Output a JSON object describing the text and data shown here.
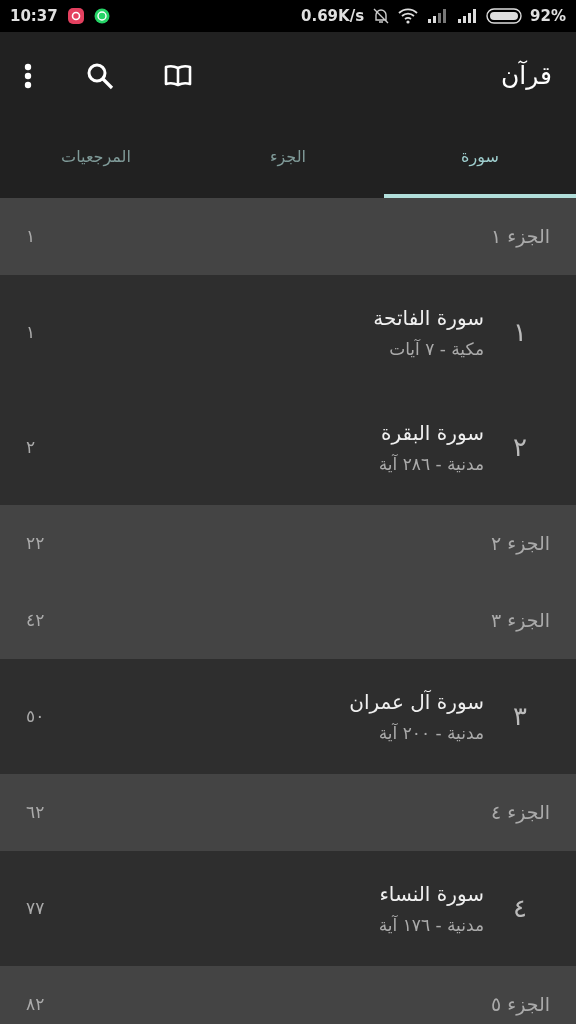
{
  "status_bar": {
    "time": "10:37",
    "speed": "0.69K/s",
    "battery": "92%"
  },
  "app_bar": {
    "title": "قرآن"
  },
  "tabs": [
    {
      "label": "سورة",
      "selected": true
    },
    {
      "label": "الجزء",
      "selected": false
    },
    {
      "label": "المرجعيات",
      "selected": false
    }
  ],
  "list": [
    {
      "kind": "juz",
      "title": "الجزء ١",
      "page": "١"
    },
    {
      "kind": "surah",
      "number": "١",
      "title": "سورة الفاتحة",
      "subtitle": "مكية - ٧ آيات",
      "page": "١"
    },
    {
      "kind": "surah",
      "number": "٢",
      "title": "سورة البقرة",
      "subtitle": "مدنية - ٢٨٦ آية",
      "page": "٢"
    },
    {
      "kind": "juz",
      "title": "الجزء ٢",
      "page": "٢٢"
    },
    {
      "kind": "juz",
      "title": "الجزء ٣",
      "page": "٤٢"
    },
    {
      "kind": "surah",
      "number": "٣",
      "title": "سورة آل عمران",
      "subtitle": "مدنية - ٢٠٠ آية",
      "page": "٥٠"
    },
    {
      "kind": "juz",
      "title": "الجزء ٤",
      "page": "٦٢"
    },
    {
      "kind": "surah",
      "number": "٤",
      "title": "سورة النساء",
      "subtitle": "مدنية - ١٧٦ آية",
      "page": "٧٧"
    },
    {
      "kind": "juz",
      "title": "الجزء ٥",
      "page": "٨٢"
    }
  ]
}
